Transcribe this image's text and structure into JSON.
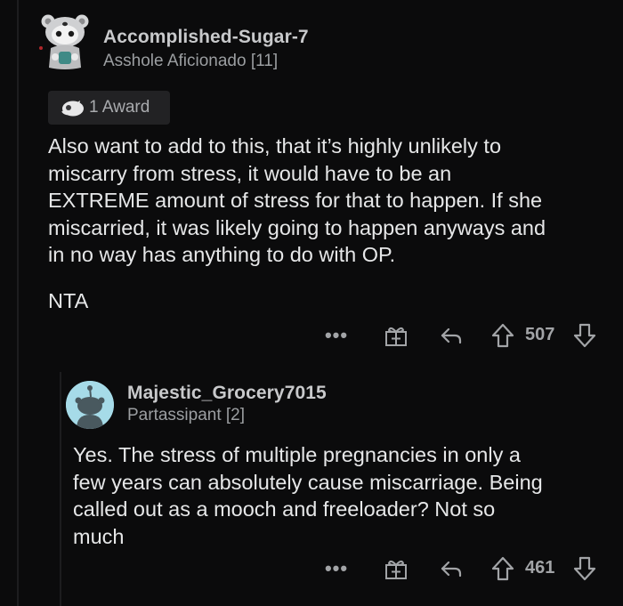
{
  "comment": {
    "username": "Accomplished-Sugar-7",
    "flair": "Asshole Aficionado [11]",
    "award_label": "1 Award",
    "body_lines": [
      "Also want to add to this, that it’s highly unlikely to",
      "miscarry from stress, it would have to be an",
      "EXTREME amount of stress for that to happen. If she",
      "miscarried, it was likely going to happen anyways and",
      "in no way has anything to do with OP."
    ],
    "verdict": "NTA",
    "vote_count": "507",
    "more_label": "•••"
  },
  "reply": {
    "username": "Majestic_Grocery7015",
    "flair": "Partassipant [2]",
    "body_lines": [
      "Yes. The stress of multiple pregnancies in only a",
      "few years can absolutely cause miscarriage. Being",
      "called out as a mooch and freeloader? Not so",
      "much"
    ],
    "vote_count": "461",
    "more_label": "•••"
  },
  "icons": {
    "more": "more-options-icon",
    "award": "gift-award-icon",
    "reply": "reply-arrow-icon",
    "upvote": "upvote-arrow-icon",
    "downvote": "downvote-arrow-icon"
  },
  "colors": {
    "background": "#0b0b0c",
    "text": "#e6e7e8",
    "muted": "#9b9ea1",
    "reply_avatar": "#a6dbe8"
  }
}
